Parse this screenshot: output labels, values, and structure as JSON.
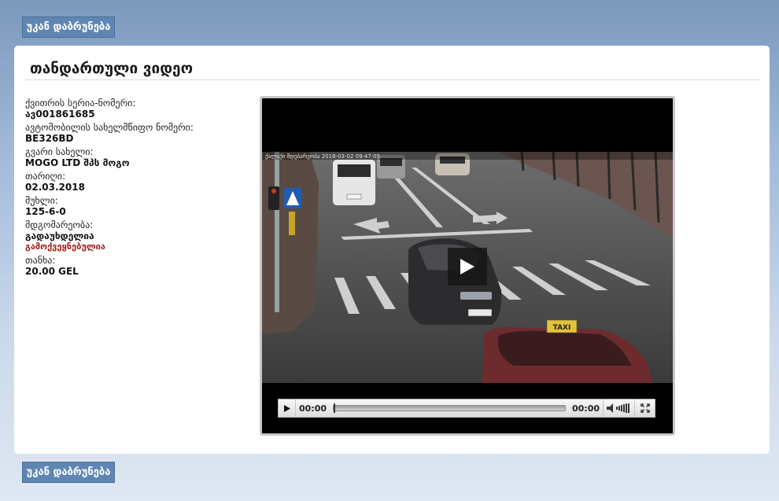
{
  "back_button_label": "უკან დაბრუნება",
  "panel": {
    "title": "თანდართული ვიდეო"
  },
  "info": [
    {
      "label": "ქვითრის სერია-ნომერი:",
      "value": "ავ001861685"
    },
    {
      "label": "ავტომობილის სახელმწიფო ნომერი:",
      "value": "BE326BD"
    },
    {
      "label": "გვარი სახელი:",
      "value": "MOGO LTD შპს მოგო"
    },
    {
      "label": "თარიღი:",
      "value": "02.03.2018"
    },
    {
      "label": "მუხლი:",
      "value": "125-6-0"
    },
    {
      "label": "მდგომარეობა:",
      "value": "გადაუხდელია",
      "sub": "გამოქვეყნებულია"
    },
    {
      "label": "თანხა:",
      "value": "20.00 GEL"
    }
  ],
  "video": {
    "overlay_timestamp": "ქალაქი მდებარეობა 2018-03-02 09:47:05",
    "current_time": "00:00",
    "duration": "00:00",
    "progress": 0,
    "plate_text": "ZZ-111-ZZ",
    "taxi_text": "TAXI"
  }
}
